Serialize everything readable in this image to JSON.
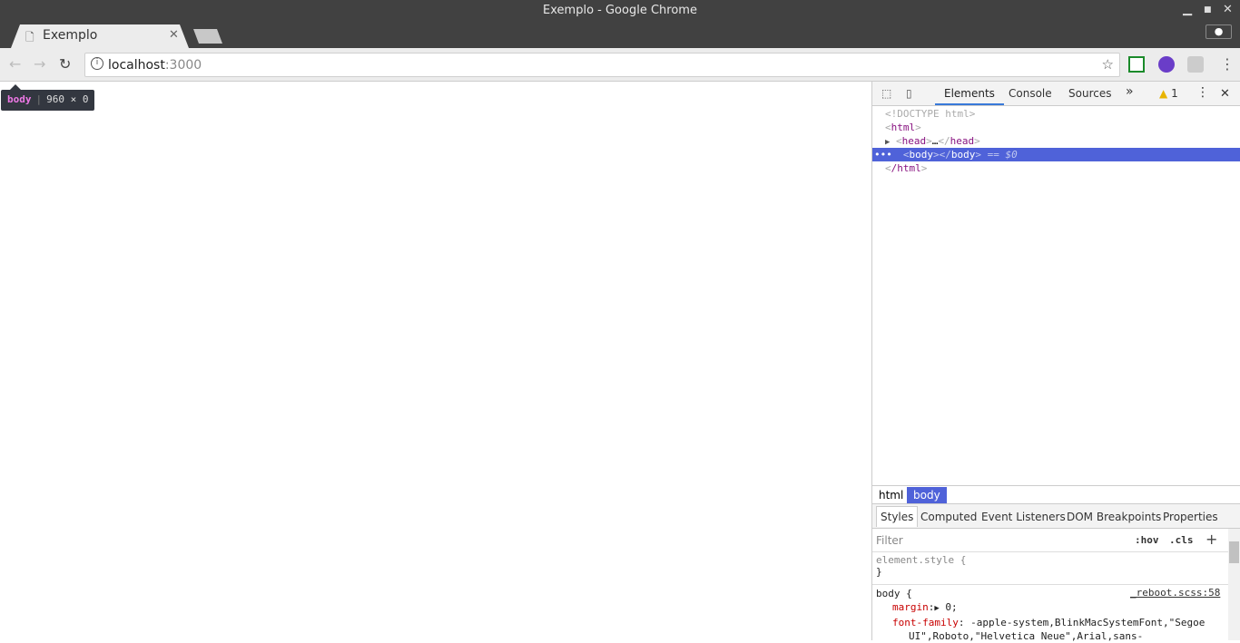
{
  "window": {
    "title": "Exemplo - Google Chrome"
  },
  "tab": {
    "title": "Exemplo"
  },
  "omnibox": {
    "host": "localhost",
    "port": ":3000"
  },
  "tooltip": {
    "tag": "body",
    "size": "960 × 0"
  },
  "devtools": {
    "tabs": [
      "Elements",
      "Console",
      "Sources"
    ],
    "more": "»",
    "warnings": "1",
    "dom": {
      "doctype": "<!DOCTYPE html>",
      "html_open": "html",
      "head": "head",
      "ellipsis": "…",
      "body": "body",
      "selected_marker": "== $0",
      "html_close": "/html"
    },
    "breadcrumbs": [
      "html",
      "body"
    ],
    "style_tabs": [
      "Styles",
      "Computed",
      "Event Listeners",
      "DOM Breakpoints",
      "Properties"
    ],
    "filter_placeholder": "Filter",
    "hov": ":hov",
    "cls": ".cls",
    "rules": {
      "element_style": "element.style {",
      "close": "}",
      "body_selector": "body {",
      "source": "_reboot.scss:58",
      "margin_prop": "margin",
      "margin_val": "0;",
      "ff_prop": "font-family",
      "ff_val": "-apple-system,BlinkMacSystemFont,\"Segoe",
      "ff_val2": "UI\",Roboto,\"Helvetica Neue\",Arial,sans-"
    }
  },
  "colors": {
    "selection": "#4f62d9",
    "accent": "#3879d9",
    "tag": "#881280"
  }
}
